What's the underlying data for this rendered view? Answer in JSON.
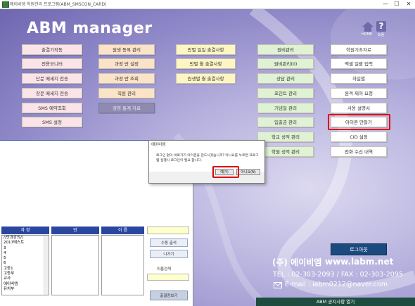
{
  "window": {
    "title": "에이비엠 학원관리 프로그램(ABM_SMSCON_CARD)",
    "minimize": "—",
    "maximize": "☐",
    "close": "✕"
  },
  "header": {
    "brand": "ABM manager",
    "home_label": "HOME",
    "help_label": "도움",
    "help_glyph": "?"
  },
  "menu": {
    "col1": [
      "출결기작동",
      "전용모니터",
      "단문 메세지 전송",
      "장문 메세지 전송",
      "SMS 예약조회",
      "SMS 설정"
    ],
    "col2": [
      "원생 등록 관리",
      "과정 반 설정",
      "과정 반 조회",
      "직원 관리",
      "경영 통계 자료"
    ],
    "col3": [
      "반별 일일 출결사항",
      "반별 월 출결사항",
      "원생별 월 출결사항"
    ],
    "col4": [
      "원비관리",
      "원비관리(II)",
      "상담 관리",
      "포인트 관리",
      "기념일 관리",
      "입출금 관리",
      "학교 성적 관리",
      "학원 성적 관리"
    ],
    "col5": [
      "학원기초자료",
      "액셀 일괄 입력",
      "차일별",
      "원격 제어 요청",
      "사용 설명서",
      "아이콘 만들기",
      "CID 설정",
      "전화 수신 내역"
    ]
  },
  "dialog": {
    "title": "에이비엠",
    "message": "로그인 없이 바로가기 아이콘을 만드시겠습니까? 아니요를 누르면 프로그램 실행시 로그인이 필요 합니다.",
    "yes": "예(Y)",
    "no": "아니요(N)"
  },
  "lists": {
    "course_header": "과 정",
    "class_header": "반",
    "name_header": "이 름",
    "courses": [
      "//단과강의//",
      "2017테스트",
      "3",
      "4",
      "5",
      "6",
      "고등1",
      "고등부",
      "교사",
      "에이비엠",
      "유치부"
    ]
  },
  "side": {
    "attendance_output": "수동 출석",
    "exit": "나가기",
    "name_search": "이름검색",
    "print_attendance": "출결장보기"
  },
  "footer": {
    "logout": "로그아웃",
    "company": "(주) 에이비엠",
    "website": "www.labm.net",
    "contact": "TEL : 02-303-2093 / FAX : 02-303-2095",
    "email": "E-mail : iabm0212@naver.com",
    "notice": "ABM 공지사항 열기"
  },
  "colors": {
    "highlight": "#e00000",
    "bg_purple": "#8f88c8",
    "header_blue": "#2a47a0"
  }
}
